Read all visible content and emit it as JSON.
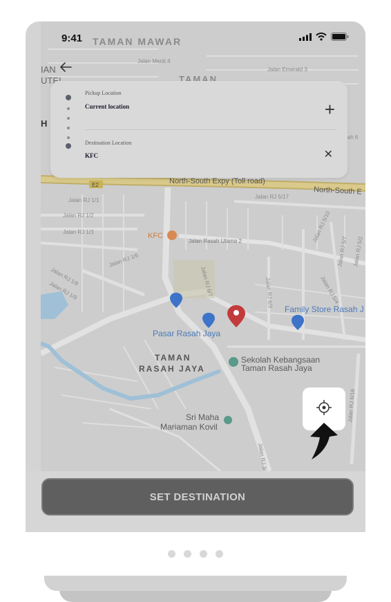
{
  "status_bar": {
    "time": "9:41"
  },
  "route_card": {
    "pickup_label": "Pickup Location",
    "pickup_value": "Current location",
    "destination_label": "Destination Location",
    "destination_value": "KFC"
  },
  "map": {
    "labels": {
      "area_top": "TAMAN MAWAR",
      "area_top2": "TAMAN",
      "jalan_menti": "Jalan Menti 4",
      "jalan_emerald": "Jalan Emerald 3",
      "toll_road": "North-South Expy (Toll road)",
      "toll_road_right": "North-South E",
      "highway_badge": "E2",
      "kfc": "KFC",
      "jalan_rasah_utama": "Jalan Rasah Utama 2",
      "pasar": "Pasar Rasah Jaya",
      "family_store": "Family Store Rasah J",
      "taman_rasah_1": "TAMAN",
      "taman_rasah_2": "RASAH JAYA",
      "sekolah_1": "Sekolah Kebangsaan",
      "sekolah_2": "Taman Rasah Jaya",
      "kovil_1": "Sri Maha",
      "kovil_2": "Mariaman Kovil",
      "rj11": "Jalan RJ 1/1",
      "rj12": "Jalan RJ 1/2",
      "rj13": "Jalan RJ 1/3",
      "rj16": "Jalan RJ 1/6",
      "rj18": "Jalan RJ 1/8",
      "rj19": "Jalan RJ 1/9",
      "rj517": "Jalan RJ 5/17",
      "rj510": "Jalan RJ 5/10",
      "rj57": "Jalan RJ 5/7",
      "rj52": "Jalan RJ 5/2",
      "rj54": "Jalan RJ 5/4",
      "rj63": "Jalan RJ 6/3",
      "rj67": "Jalan RJ 6/7",
      "rj3": "Jalan RJ 3/",
      "rj616": "Jalan RJ 6/16",
      "left_fragment": "IAN",
      "left_fragment2": "UTEI",
      "left_fragment3": "H",
      "right_fragment": "lah 6"
    }
  },
  "actions": {
    "set_destination": "SET DESTINATION"
  },
  "pager": {
    "count": 4
  }
}
